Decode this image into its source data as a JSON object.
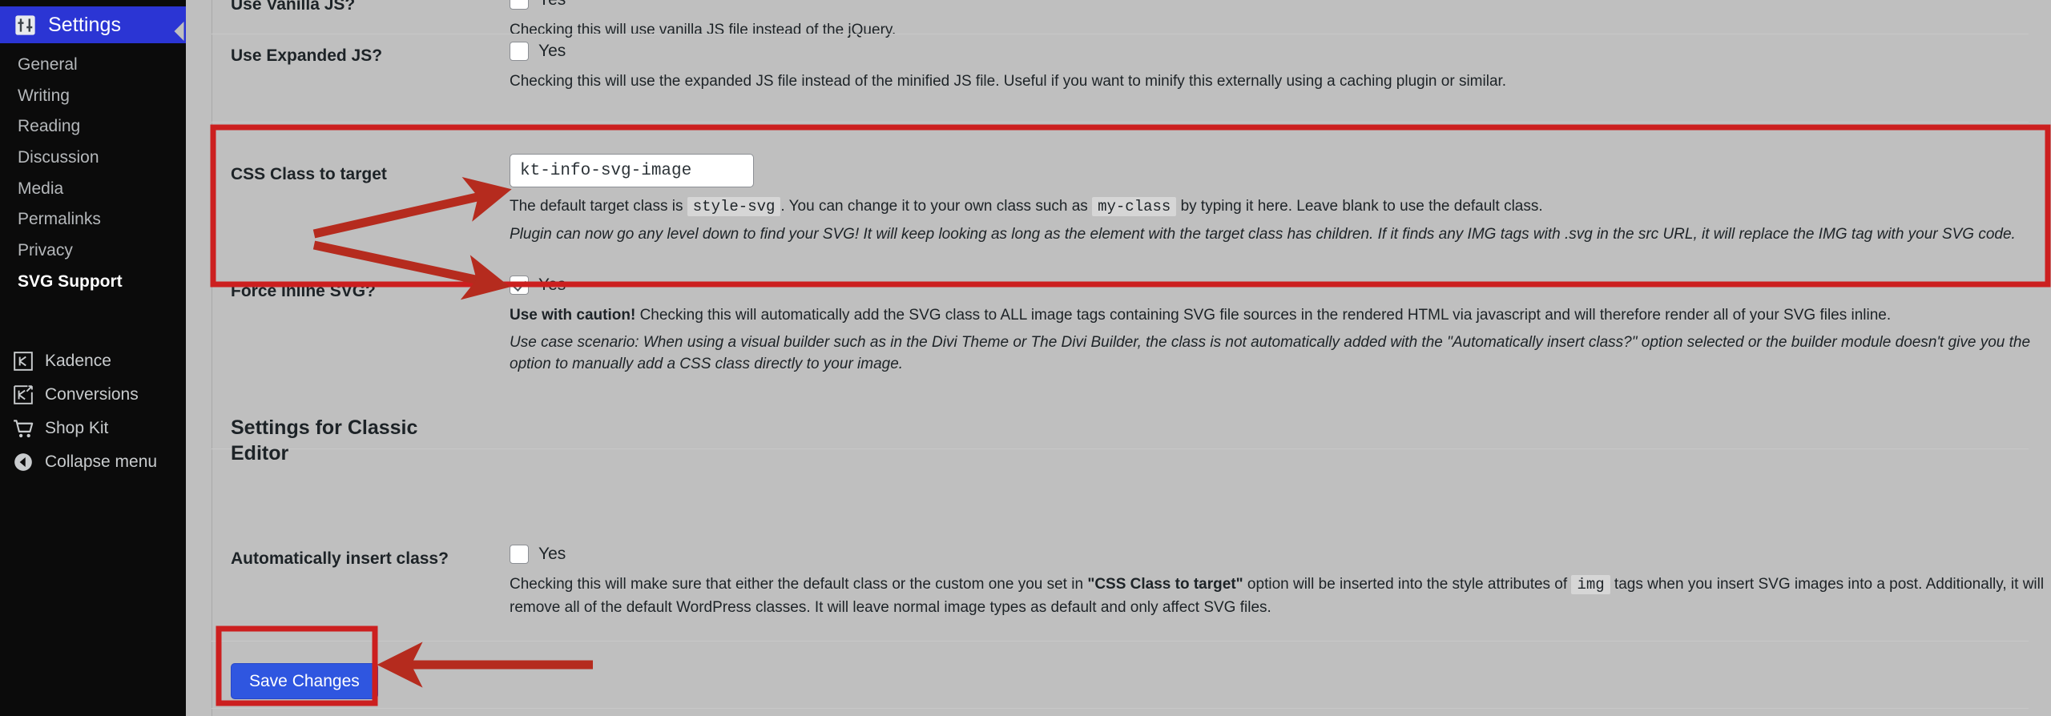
{
  "sidebar": {
    "current": {
      "label": "Settings",
      "icon": "settings-sliders-icon"
    },
    "submenu": [
      {
        "label": "General",
        "active": false
      },
      {
        "label": "Writing",
        "active": false
      },
      {
        "label": "Reading",
        "active": false
      },
      {
        "label": "Discussion",
        "active": false
      },
      {
        "label": "Media",
        "active": false
      },
      {
        "label": "Permalinks",
        "active": false
      },
      {
        "label": "Privacy",
        "active": false
      },
      {
        "label": "SVG Support",
        "active": true
      }
    ],
    "lower": [
      {
        "label": "Kadence",
        "icon": "kadence-icon"
      },
      {
        "label": "Conversions",
        "icon": "conversions-icon"
      },
      {
        "label": "Shop Kit",
        "icon": "cart-icon"
      },
      {
        "label": "Collapse menu",
        "icon": "collapse-arrow-icon"
      }
    ],
    "colors": {
      "active_bg": "#2b35d4",
      "bg": "#0b0b0b",
      "text": "#b5b8bb"
    }
  },
  "form": {
    "rows": [
      {
        "label": "Use Vanilla JS?",
        "checkbox_label": "Yes",
        "checked": false,
        "desc": "Checking this will use vanilla JS file instead of the jQuery."
      },
      {
        "label": "Use Expanded JS?",
        "checkbox_label": "Yes",
        "checked": false,
        "desc": "Checking this will use the expanded JS file instead of the minified JS file. Useful if you want to minify this externally using a caching plugin or similar."
      },
      {
        "label": "CSS Class to target",
        "input_value": "kt-info-svg-image",
        "input_placeholder": "style-svg",
        "desc_pre": "The default target class is ",
        "desc_code1": "style-svg",
        "desc_mid": ". You can change it to your own class such as ",
        "desc_code2": "my-class",
        "desc_post": " by typing it here. Leave blank to use the default class.",
        "desc_italic": "Plugin can now go any level down to find your SVG! It will keep looking as long as the element with the target class has children. If it finds any IMG tags with .svg in the src URL, it will replace the IMG tag with your SVG code."
      },
      {
        "label": "Force Inline SVG?",
        "checkbox_label": "Yes",
        "checked": true,
        "desc_bold": "Use with caution!",
        "desc_rest": " Checking this will automatically add the SVG class to ALL image tags containing SVG file sources in the rendered HTML via javascript and will therefore render all of your SVG files inline.",
        "desc_italic": "Use case scenario: When using a visual builder such as in the Divi Theme or The Divi Builder, the class is not automatically added with the \"Automatically insert class?\" option selected or the builder module doesn't give you the option to manually add a CSS class directly to your image."
      }
    ],
    "section_heading": "Settings for Classic Editor",
    "auto_insert": {
      "label": "Automatically insert class?",
      "checkbox_label": "Yes",
      "checked": false,
      "desc_pre": "Checking this will make sure that either the default class or the custom one you set in ",
      "desc_bold": "\"CSS Class to target\"",
      "desc_mid": " option will be inserted into the style attributes of ",
      "desc_code": "img",
      "desc_post": " tags when you insert SVG images into a post. Additionally, it will remove all of the default WordPress classes. It will leave normal image types as default and only affect SVG files."
    },
    "save_button": "Save Changes"
  },
  "annotations": {
    "highlight_color": "#cc1f1f",
    "arrow_color": "#b52b1e",
    "boxes": [
      "css-class-and-force-inline-section",
      "save-changes-button"
    ],
    "arrows": [
      "arrow-to-css-class-field",
      "arrow-to-force-inline-checkbox",
      "arrow-to-save-changes"
    ]
  }
}
